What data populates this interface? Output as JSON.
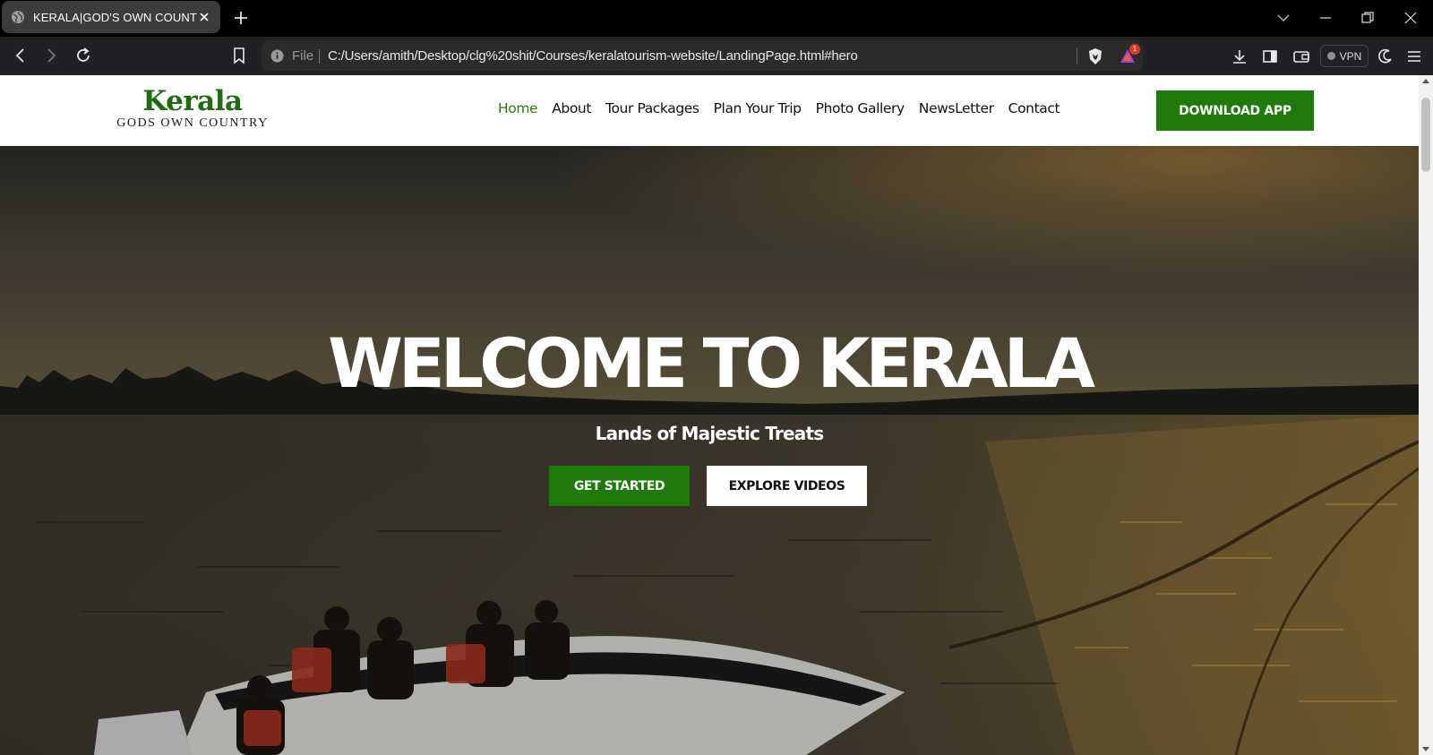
{
  "browser": {
    "tab_title": "KERALA|GOD'S OWN COUNTRY",
    "address_scheme": "File",
    "address_url": "C:/Users/amith/Desktop/clg%20shit/Courses/keralatourism-website/LandingPage.html#hero",
    "rewards_badge": "1",
    "vpn_label": "VPN",
    "icons": [
      "globe-icon",
      "close-icon",
      "plus-icon",
      "chevron-down-icon",
      "minimize-icon",
      "restore-icon",
      "close-window-icon",
      "back-icon",
      "forward-icon",
      "reload-icon",
      "bookmark-icon",
      "info-icon",
      "brave-shield-icon",
      "brave-rewards-icon",
      "download-icon",
      "sidebar-icon",
      "wallet-icon",
      "leo-icon",
      "menu-icon"
    ]
  },
  "site": {
    "logo": {
      "main": "Kerala",
      "sub": "GODS OWN COUNTRY"
    },
    "nav": [
      {
        "label": "Home",
        "active": true
      },
      {
        "label": "About"
      },
      {
        "label": "Tour Packages"
      },
      {
        "label": "Plan Your Trip"
      },
      {
        "label": "Photo Gallery"
      },
      {
        "label": "NewsLetter"
      },
      {
        "label": "Contact"
      }
    ],
    "download_button": "DOWNLOAD APP",
    "accent_color": "#1f7a0c"
  },
  "hero": {
    "title": "WELCOME TO KERALA",
    "subtitle": "Lands of Majestic Treats",
    "primary_button": "GET STARTED",
    "secondary_button": "EXPLORE VIDEOS",
    "background": "sunset backwater with speedboat photo"
  }
}
